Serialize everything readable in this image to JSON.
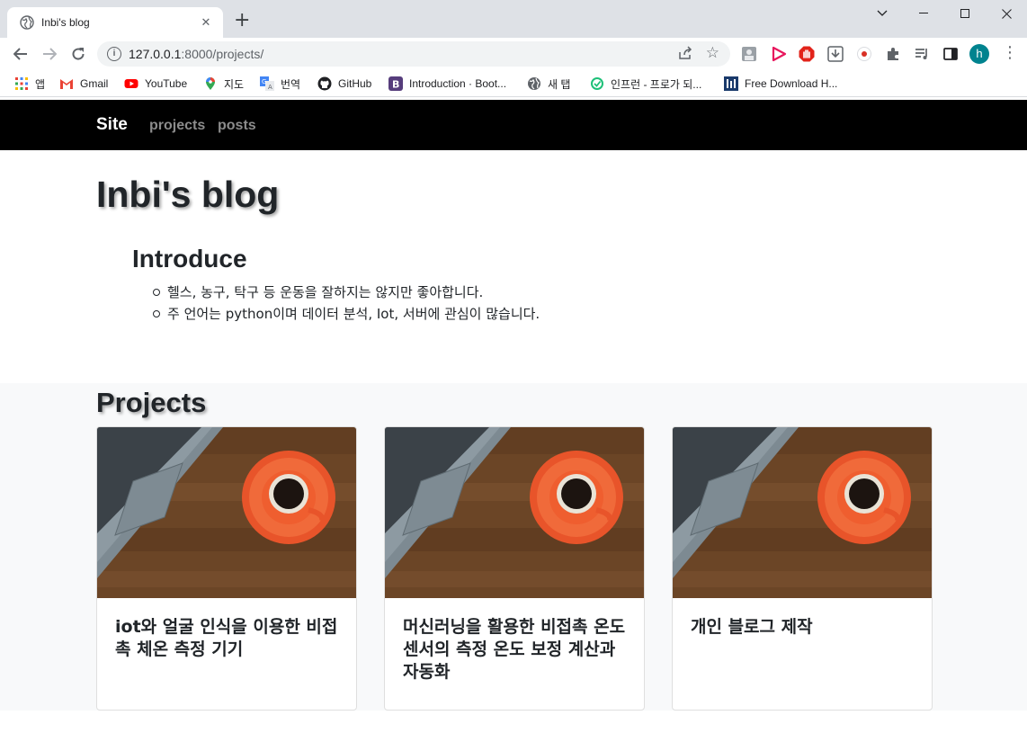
{
  "browser": {
    "tab_title": "Inbi's blog",
    "url_host": "127.0.0.1",
    "url_rest": ":8000/projects/",
    "profile_initial": "h",
    "bookmarks": [
      {
        "label": "앱",
        "icon": "apps-grid-icon"
      },
      {
        "label": "Gmail",
        "icon": "gmail-icon"
      },
      {
        "label": "YouTube",
        "icon": "youtube-icon"
      },
      {
        "label": "지도",
        "icon": "maps-pin-icon"
      },
      {
        "label": "번역",
        "icon": "translate-icon"
      },
      {
        "label": "GitHub",
        "icon": "github-icon"
      },
      {
        "label": "Introduction · Boot...",
        "icon": "bootstrap-icon"
      },
      {
        "label": "새 탭",
        "icon": "globe-icon"
      },
      {
        "label": "인프런 - 프로가 되...",
        "icon": "inflearn-icon"
      },
      {
        "label": "Free Download H...",
        "icon": "download-site-icon"
      }
    ]
  },
  "site": {
    "brand": "Site",
    "nav": [
      "projects",
      "posts"
    ]
  },
  "blog": {
    "title": "Inbi's blog",
    "intro_heading": "Introduce",
    "intro_items": [
      "헬스, 농구, 탁구 등 운동을 잘하지는 않지만 좋아합니다.",
      "주 언어는 python이며 데이터 분석, Iot, 서버에 관심이 많습니다."
    ]
  },
  "projects": {
    "heading": "Projects",
    "cards": [
      {
        "title": "iot와 얼굴 인식을 이용한 비접촉 체온 측정 기기"
      },
      {
        "title": "머신러닝을 활용한 비접촉 온도센서의 측정 온도 보정 계산과 자동화"
      },
      {
        "title": "개인 블로그 제작"
      }
    ]
  },
  "colors": {
    "navbar": "#000000",
    "nav_link": "#8c8c8c",
    "section_bg": "#f8f9fa",
    "profile": "#00838f"
  }
}
